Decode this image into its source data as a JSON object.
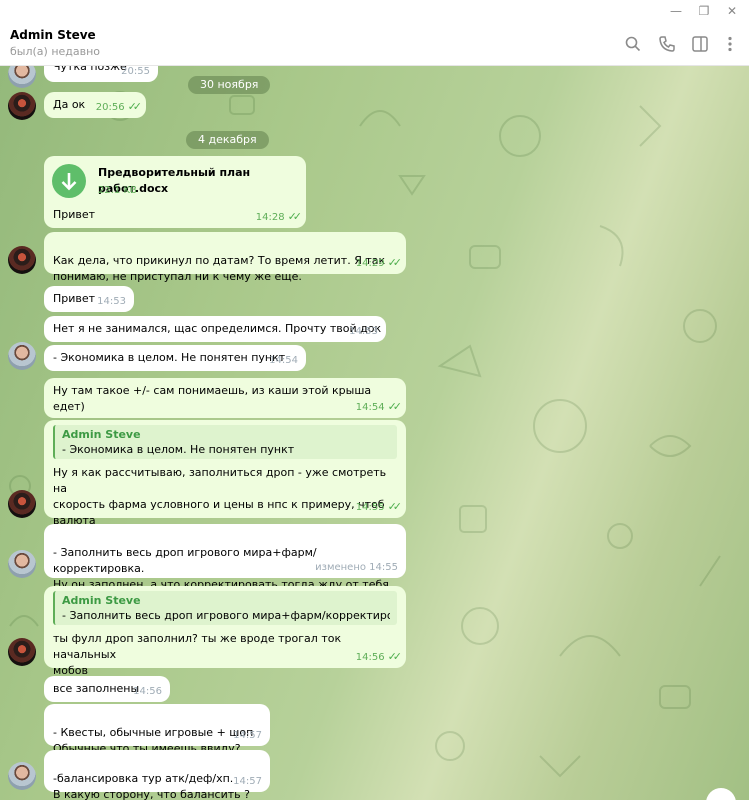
{
  "window": {
    "minimize": "—",
    "restore": "❐",
    "close": "✕"
  },
  "chat_header": {
    "name": "Admin Steve",
    "status": "был(а) недавно",
    "icons": [
      "search-icon",
      "phone-icon",
      "sidebar-icon",
      "more-icon"
    ]
  },
  "dates": [
    "30 ноября",
    "4 декабря"
  ],
  "messages": [
    {
      "dir": "in",
      "text": "Чутка позже",
      "time": "20:55"
    },
    {
      "dir": "out",
      "text": "Да ок",
      "time": "20:56"
    },
    {
      "dir": "out",
      "kind": "file",
      "file_name": "Предворительный план работ.docx",
      "file_size": "22.1 KB",
      "text": "Привет",
      "time": "14:28"
    },
    {
      "dir": "out",
      "text": "Как дела, что прикинул по датам? То время летит. Я так\nпонимаю, не приступал ни к чему же еще.",
      "time": "14:29"
    },
    {
      "dir": "in",
      "text": "Привет",
      "time": "14:53"
    },
    {
      "dir": "in",
      "text": "Нет я не занимался, щас определимся. Прочту твой док",
      "time": "14:53"
    },
    {
      "dir": "in",
      "text": "- Экономика в целом. Не понятен пункт",
      "time": "14:54"
    },
    {
      "dir": "out",
      "text": "Ну там такое +/- сам понимаешь, из каши этой крыша едет)",
      "time": "14:54"
    },
    {
      "dir": "out",
      "reply_name": "Admin Steve",
      "reply_text": "- Экономика в целом. Не понятен пункт",
      "text": "Ну я как рассчитываю, заполниться дроп - уже смотреть на\nскорость фарма условного и цены в нпс к примеру, чтоб валюта\nбыла актуальная.",
      "time": "14:55"
    },
    {
      "dir": "in",
      "text": "- Заполнить весь дроп игрового мира+фарм/корректировка.\nНу он заполнен, а что корректировать тогда жду от тебя",
      "edited": "изменено",
      "time": "14:55"
    },
    {
      "dir": "out",
      "reply_name": "Admin Steve",
      "reply_text": "- Заполнить весь дроп игрового мира+фарм/корректировка...",
      "text": "ты фулл дроп заполнил? ты же вроде трогал ток начальных\nмобов",
      "time": "14:56"
    },
    {
      "dir": "in",
      "text": "все заполнены",
      "time": "14:56"
    },
    {
      "dir": "in",
      "text": "- Квесты, обычные игровые + шоп\nОбычные что ты имеешь ввиду?",
      "time": "14:57"
    },
    {
      "dir": "in",
      "text": "-балансировка тур атк/деф/хп.\nВ какую сторону, что балансить ?",
      "time": "14:57"
    }
  ],
  "colors": {
    "incoming": "#ffffff",
    "outgoing": "#effdde",
    "accent": "#5fae58"
  }
}
